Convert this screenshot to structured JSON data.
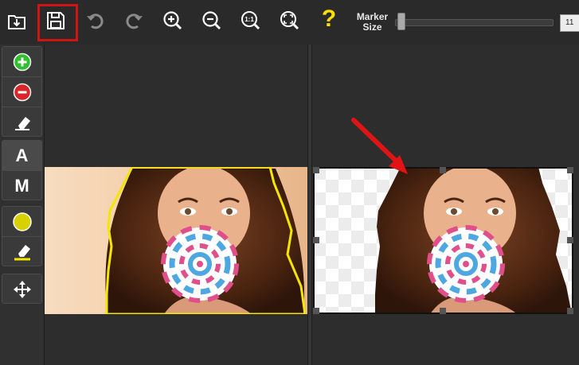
{
  "toolbar": {
    "items": [
      {
        "icon": "open-folder-icon"
      },
      {
        "icon": "save-icon"
      },
      {
        "icon": "undo-icon"
      },
      {
        "icon": "redo-icon"
      },
      {
        "icon": "zoom-in-icon"
      },
      {
        "icon": "zoom-out-icon"
      },
      {
        "icon": "actual-size-icon",
        "text": "1:1"
      },
      {
        "icon": "fit-screen-icon"
      },
      {
        "icon": "help-icon",
        "text": "?"
      }
    ],
    "marker_label_line1": "Marker",
    "marker_label_line2": "Size",
    "marker_size_value": "11",
    "marker_size_fraction": 0.02
  },
  "sidebar": {
    "tools": [
      {
        "icon": "add-marker-icon"
      },
      {
        "icon": "remove-marker-icon"
      },
      {
        "icon": "eraser-icon"
      },
      {
        "icon": "auto-mode-icon",
        "label": "A"
      },
      {
        "icon": "manual-mode-icon",
        "label": "M"
      },
      {
        "icon": "yellow-marker-icon"
      },
      {
        "icon": "marker-eraser-icon"
      },
      {
        "icon": "move-icon"
      }
    ]
  },
  "colors": {
    "highlight_red": "#d01414",
    "selection_yellow": "#f5e600",
    "help_yellow": "#ffde00",
    "add_green": "#2fbf2f",
    "remove_red": "#d9252a"
  }
}
